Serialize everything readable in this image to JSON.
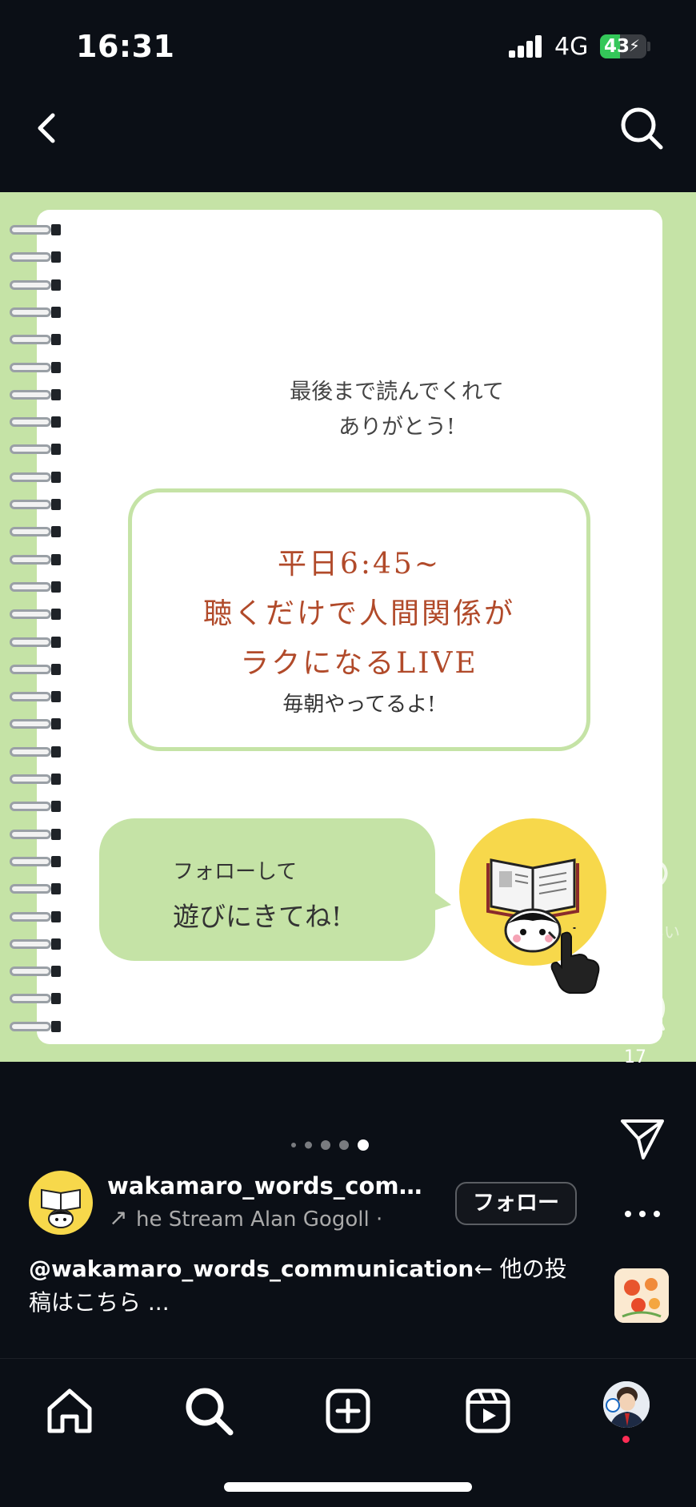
{
  "status_bar": {
    "time": "16:31",
    "network": "4G",
    "battery": "43",
    "battery_level": 0.43
  },
  "post": {
    "intro_line1": "最後まで読んでくれて",
    "intro_line2": "ありがとう!",
    "live_line1": "平日6:45~",
    "live_line2": "聴くだけで人間関係が",
    "live_line3": "ラクになるLIVE",
    "live_sub": "毎朝やってるよ!",
    "bubble_line1": "フォローして",
    "bubble_line2": "遊びにきてね!"
  },
  "actions": {
    "like_label": "いい",
    "comment_count": "17"
  },
  "carousel": {
    "total": 5,
    "active": 4
  },
  "author": {
    "username": "wakamaro_words_comm...",
    "music": "he Stream    Alan Gogoll ·",
    "follow_label": "フォロー"
  },
  "caption": {
    "handle": "@wakamaro_words_communication",
    "text": "← 他の投稿はこちら ..."
  },
  "icons": {
    "back": "chevron-left-icon",
    "search": "search-icon",
    "like": "heart-icon",
    "comment": "comment-icon",
    "share": "send-icon",
    "more": "more-icon",
    "home": "home-icon",
    "explore": "search-icon",
    "create": "plus-square-icon",
    "reels": "reels-icon"
  },
  "colors": {
    "background": "#0b0f16",
    "accent_green": "#c5e3a6",
    "text_brown": "#b14a2a",
    "yellow": "#f7d84b"
  }
}
